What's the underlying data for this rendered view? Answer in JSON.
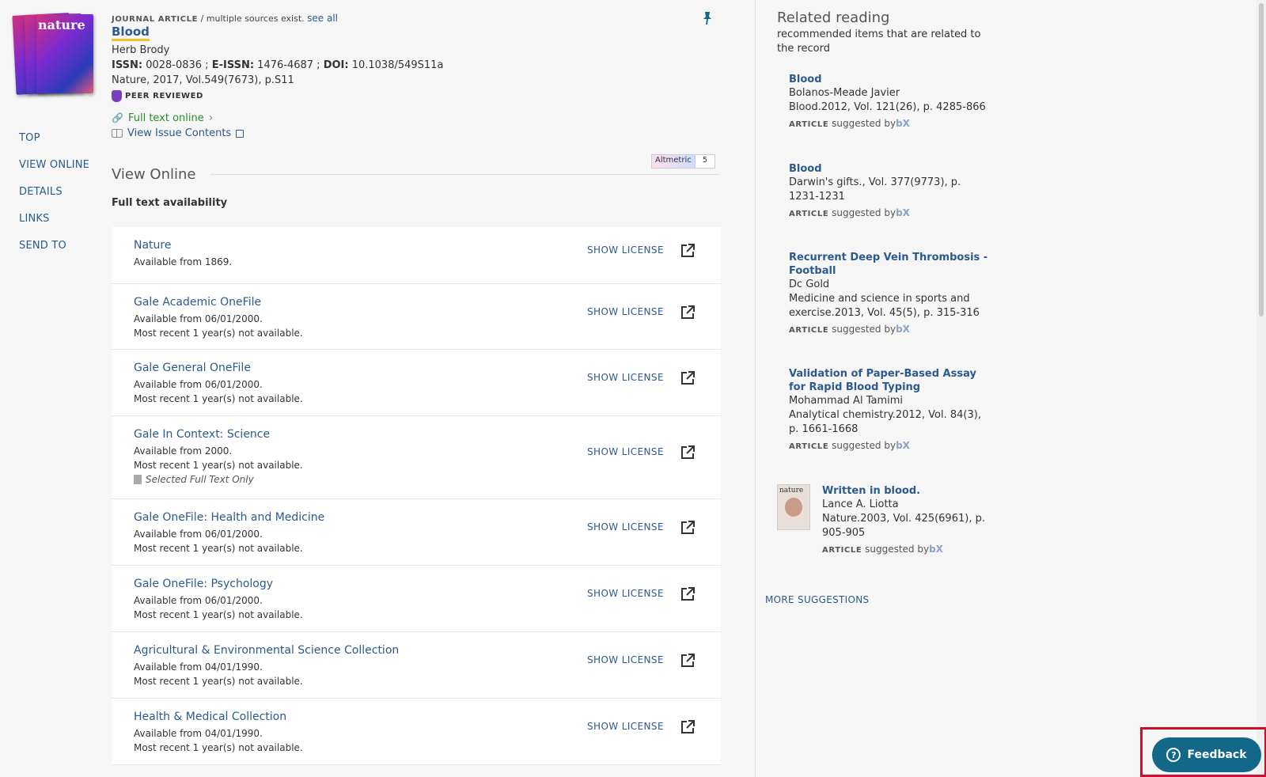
{
  "record": {
    "type_label": "JOURNAL ARTICLE",
    "sources_text": " / multiple sources exist. ",
    "see_all": "see all",
    "title": "Blood",
    "author": "Herb Brody",
    "issn_label": "ISSN:",
    "issn": " 0028-0836 ; ",
    "eissn_label": "E-ISSN:",
    "eissn": " 1476-4687 ; ",
    "doi_label": "DOI:",
    "doi": " 10.1038/549S11a",
    "citation": "Nature, 2017, Vol.549(7673), p.S11",
    "peer_reviewed": "PEER REVIEWED",
    "full_text_online": "Full text online",
    "view_issue_contents": "View Issue Contents",
    "cover_text": "nature"
  },
  "left_nav": [
    "TOP",
    "VIEW ONLINE",
    "DETAILS",
    "LINKS",
    "SEND TO"
  ],
  "altmetric": {
    "label": "Altmetric",
    "score": "5"
  },
  "view_online": {
    "heading": "View Online",
    "subheading": "Full text availability",
    "show_license": "SHOW LICENSE",
    "sources": [
      {
        "name": "Nature",
        "lines": [
          "Available from 1869."
        ],
        "note": ""
      },
      {
        "name": "Gale Academic OneFile",
        "lines": [
          "Available from 06/01/2000.",
          "Most recent 1 year(s) not available."
        ],
        "note": ""
      },
      {
        "name": "Gale General OneFile",
        "lines": [
          "Available from 06/01/2000.",
          "Most recent 1 year(s) not available."
        ],
        "note": ""
      },
      {
        "name": "Gale In Context: Science",
        "lines": [
          "Available from 2000.",
          "Most recent 1 year(s) not available."
        ],
        "note": "Selected Full Text Only"
      },
      {
        "name": "Gale OneFile: Health and Medicine",
        "lines": [
          "Available from 06/01/2000.",
          "Most recent 1 year(s) not available."
        ],
        "note": ""
      },
      {
        "name": "Gale OneFile: Psychology",
        "lines": [
          "Available from 06/01/2000.",
          "Most recent 1 year(s) not available."
        ],
        "note": ""
      },
      {
        "name": "Agricultural & Environmental Science Collection",
        "lines": [
          "Available from 04/01/1990.",
          "Most recent 1 year(s) not available."
        ],
        "note": ""
      },
      {
        "name": "Health & Medical Collection",
        "lines": [
          "Available from 04/01/1990.",
          "Most recent 1 year(s) not available."
        ],
        "note": ""
      }
    ]
  },
  "related": {
    "heading": "Related reading",
    "subheading": "recommended items that are related to the record",
    "type_label": "ARTICLE",
    "suggested_by": " suggested by",
    "bx": "bX",
    "items": [
      {
        "title": "Blood",
        "author": "Bolanos-Meade Javier",
        "source": "Blood.2012, Vol. 121(26), p. 4285-866"
      },
      {
        "title": "Blood",
        "author": "",
        "source": "Darwin's gifts., Vol. 377(9773), p. 1231-1231"
      },
      {
        "title": "Recurrent Deep Vein Thrombosis - Football",
        "author": "Dc Gold",
        "source": "Medicine and science in sports and exercise.2013, Vol. 45(5), p. 315-316"
      },
      {
        "title": "Validation of Paper-Based Assay for Rapid Blood Typing",
        "author": "Mohammad Al Tamimi",
        "source": "Analytical chemistry.2012, Vol. 84(3), p. 1661-1668"
      },
      {
        "title": "Written in blood.",
        "author": "Lance A. Liotta",
        "source": "Nature.2003, Vol. 425(6961), p. 905-905",
        "thumb_text": "nature"
      }
    ],
    "more": "MORE SUGGESTIONS"
  },
  "feedback": {
    "label": "Feedback"
  },
  "colors": {
    "link": "#2c5a8c",
    "fulltext": "#2c8a2c",
    "feedback_bg": "#13688a",
    "highlight_frame": "#d0102a",
    "title_underline": "#f2c31c"
  }
}
